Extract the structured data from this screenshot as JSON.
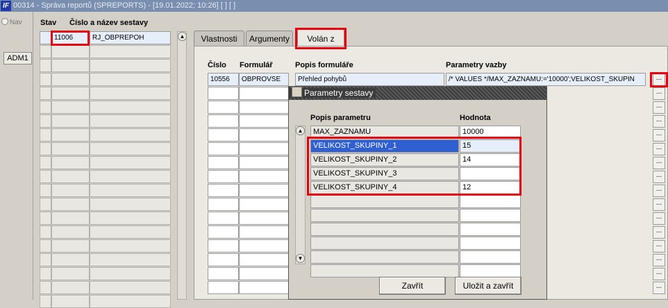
{
  "window": {
    "title": "00314 - Správa reportů (SPREPORTS) - [19.01.2022; 10:26]  [ ]  [ ]",
    "logo": "IF"
  },
  "nav": {
    "label": "Nav",
    "adm_button": "ADM1"
  },
  "list": {
    "headers": {
      "stav": "Stav",
      "cislo_nazev": "Číslo a název sestavy"
    },
    "selected": {
      "cislo": "11006",
      "nazev": "RJ_OBPREPOH"
    }
  },
  "tabs": [
    {
      "label": "Vlastnosti"
    },
    {
      "label": "Argumenty"
    },
    {
      "label": "Volán z"
    }
  ],
  "volan": {
    "headers": {
      "cislo": "Číslo",
      "formular": "Formulář",
      "popis": "Popis formuláře",
      "parametry": "Parametry vazby"
    },
    "row": {
      "cislo": "10556",
      "formular": "OBPROVSE",
      "popis": "Přehled pohybů",
      "parametry": "/* VALUES */MAX_ZAZNAMU:='10000';VELIKOST_SKUPIN"
    },
    "more_label": "..."
  },
  "dialog": {
    "title": "Parametry sestavy",
    "headers": {
      "popis": "Popis parametru",
      "hodnota": "Hodnota"
    },
    "params": [
      {
        "name": "MAX_ZAZNAMU",
        "value": "10000"
      },
      {
        "name": "VELIKOST_SKUPINY_1",
        "value": "15"
      },
      {
        "name": "VELIKOST_SKUPINY_2",
        "value": "14"
      },
      {
        "name": "VELIKOST_SKUPINY_3",
        "value": ""
      },
      {
        "name": "VELIKOST_SKUPINY_4",
        "value": "12"
      }
    ],
    "close_button": "Zavřít",
    "save_close_button": "Uložit a zavřít"
  },
  "colors": {
    "highlight": "#e8000f",
    "titlebar": "#7a8fb0",
    "selection": "#2f5fd0"
  }
}
